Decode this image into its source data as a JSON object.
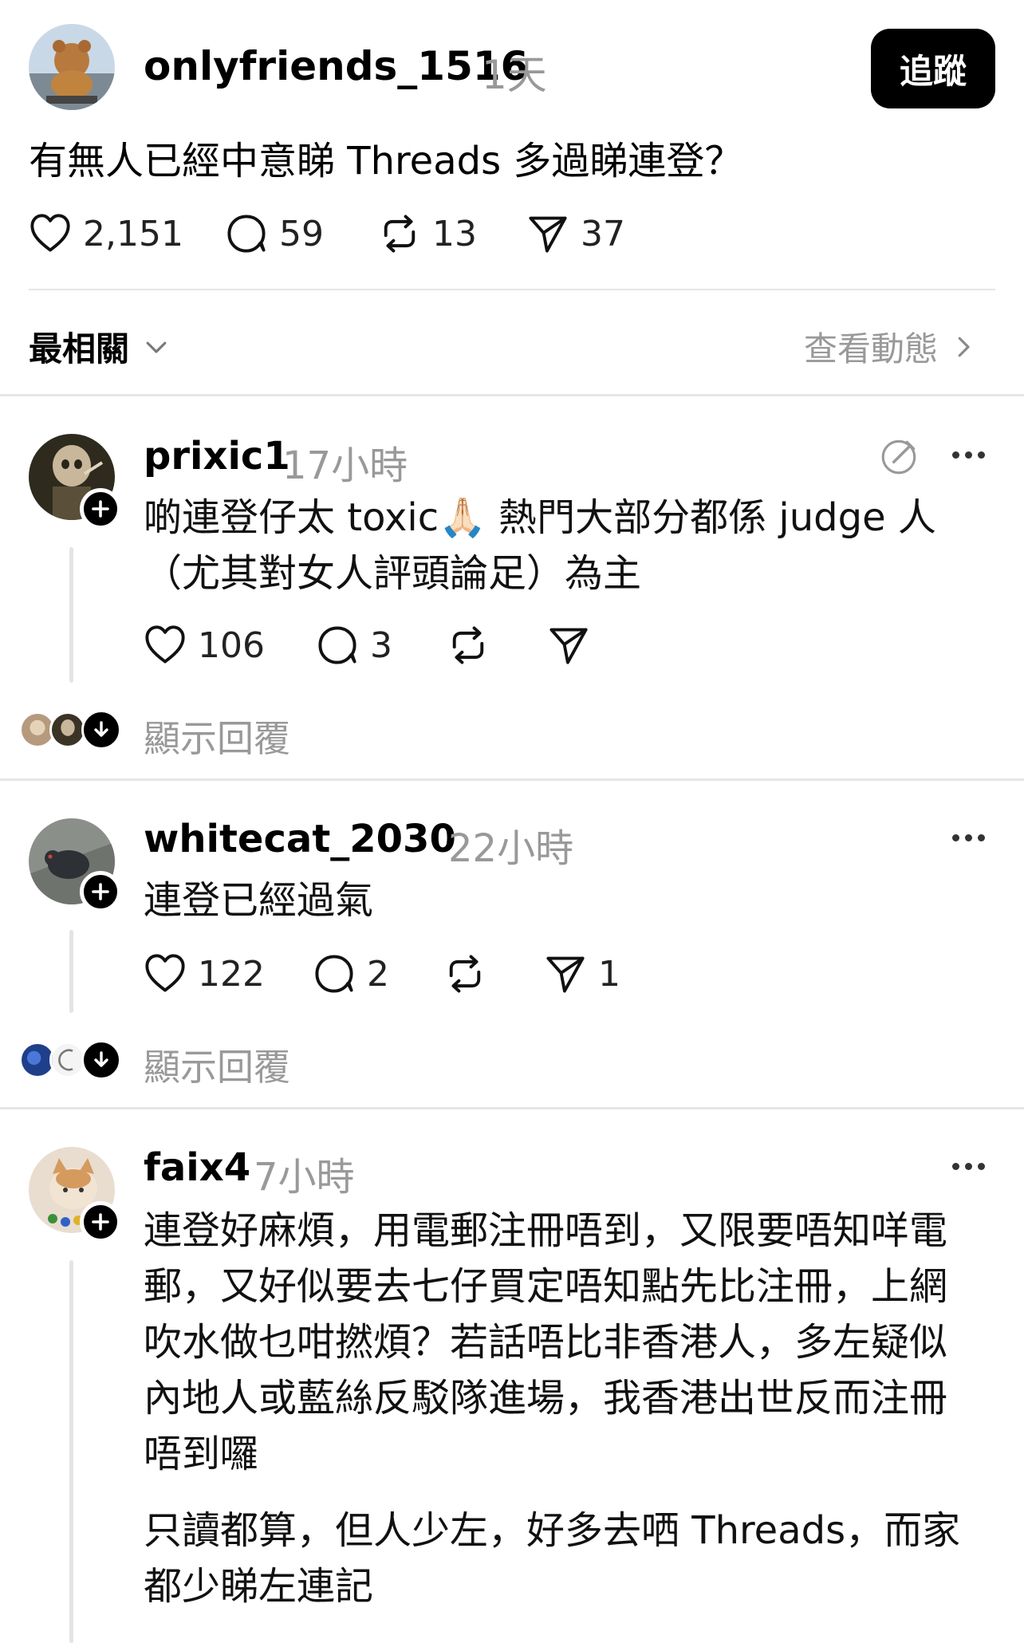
{
  "post": {
    "username": "onlyfriends_1516",
    "time": "1天",
    "follow_label": "追蹤",
    "text": "有無人已經中意睇 Threads 多過睇連登？",
    "likes": "2,151",
    "comments": "59",
    "reposts": "13",
    "shares": "37"
  },
  "sort": {
    "label": "最相關",
    "activity_link": "查看動態"
  },
  "replies": [
    {
      "username": "prixic1",
      "time": "17小時",
      "line1": "啲連登仔太 toxic",
      "emoji": "🙏🏻",
      "line1b": " 熱門大部分都係 judge 人",
      "line2": "（尤其對女人評頭論足）為主",
      "likes": "106",
      "comments": "3",
      "show_replies": "顯示回覆"
    },
    {
      "username": "whitecat_2030",
      "time": "22小時",
      "line1": "連登已經過氣",
      "likes": "122",
      "comments": "2",
      "shares": "1",
      "show_replies": "顯示回覆"
    },
    {
      "username": "faix4",
      "time": "7小時",
      "para1": [
        "連登好麻煩，用電郵注冊唔到，又限要唔知咩電",
        "郵，又好似要去七仔買定唔知點先比注冊，上網",
        "吹水做乜咁撚煩？若話唔比非香港人，多左疑似",
        "內地人或藍絲反駁隊進場，我香港出世反而注冊",
        "唔到囉"
      ],
      "para2": [
        "只讀都算，但人少左，好多去哂 Threads，而家",
        "都少睇左連記"
      ]
    }
  ],
  "icons": {
    "like": "heart-icon",
    "comment": "comment-bubble-icon",
    "repost": "repost-icon",
    "share": "send-icon",
    "more": "more-dots-icon",
    "plus": "plus-icon",
    "chevron_down": "chevron-down-icon",
    "chevron_right": "chevron-right-icon",
    "arrow_down": "arrow-down-icon",
    "edit": "edit-circle-icon"
  }
}
